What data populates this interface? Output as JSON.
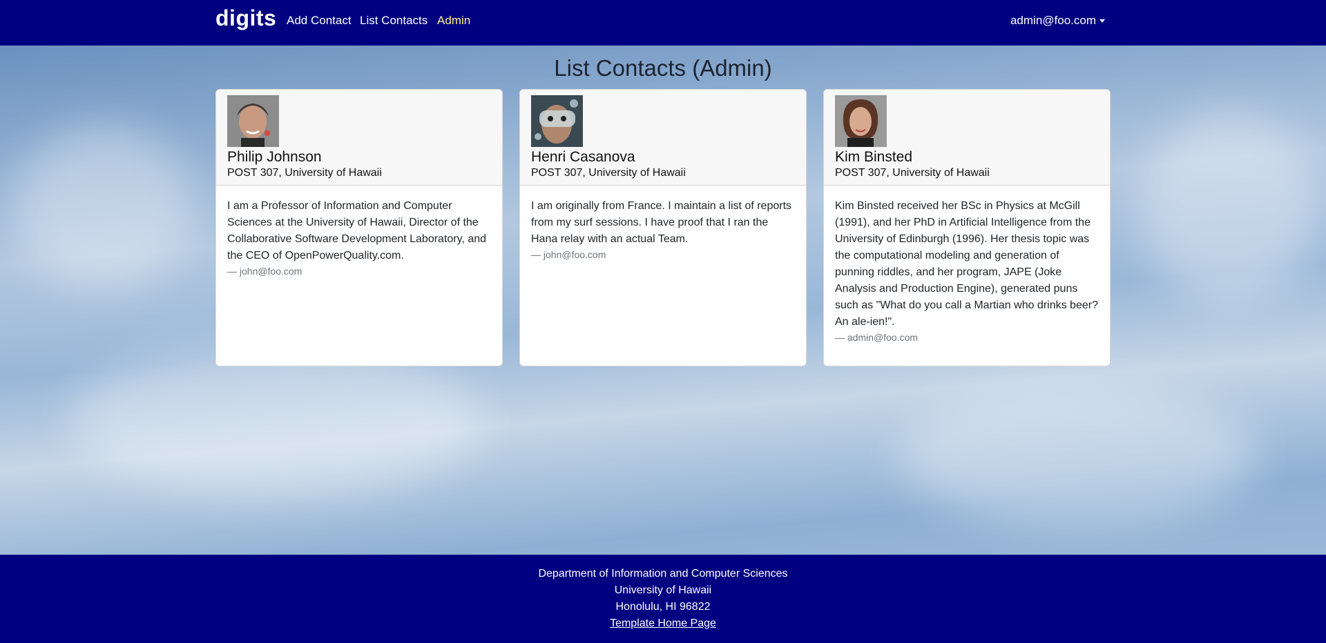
{
  "navbar": {
    "brand": "digits",
    "links": [
      "Add Contact",
      "List Contacts",
      "Admin"
    ],
    "user": "admin@foo.com",
    "colors": {
      "background": "#000080",
      "active": "#fff38a"
    }
  },
  "page": {
    "title": "List Contacts (Admin)"
  },
  "contacts": [
    {
      "name": "Philip Johnson",
      "address": "POST 307, University of Hawaii",
      "description": "I am a Professor of Information and Computer Sciences at the University of Hawaii, Director of the Collaborative Software Development Laboratory, and the CEO of OpenPowerQuality.com.",
      "owner": "— john@foo.com"
    },
    {
      "name": "Henri Casanova",
      "address": "POST 307, University of Hawaii",
      "description": "I am originally from France. I maintain a list of reports from my surf sessions. I have proof that I ran the Hana relay with an actual Team.",
      "owner": "— john@foo.com"
    },
    {
      "name": "Kim Binsted",
      "address": "POST 307, University of Hawaii",
      "description": "Kim Binsted received her BSc in Physics at McGill (1991), and her PhD in Artificial Intelligence from the University of Edinburgh (1996). Her thesis topic was the computational modeling and generation of punning riddles, and her program, JAPE (Joke Analysis and Production Engine), generated puns such as \"What do you call a Martian who drinks beer? An ale-ien!\".",
      "owner": "— admin@foo.com"
    }
  ],
  "footer": {
    "line1": "Department of Information and Computer Sciences",
    "line2": "University of Hawaii",
    "line3": "Honolulu, HI 96822",
    "link": "Template Home Page"
  }
}
